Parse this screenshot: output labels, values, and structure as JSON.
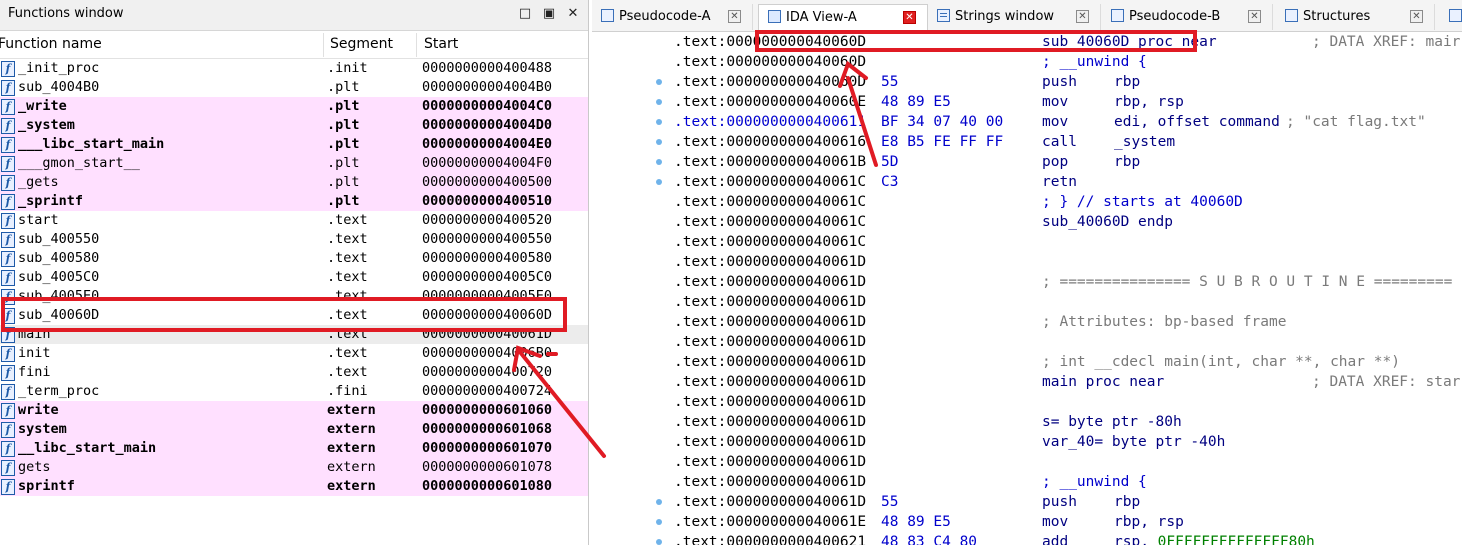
{
  "functions_window": {
    "title": "Functions window",
    "buttons": {
      "minimize": "□",
      "float": "▣",
      "close": "✕"
    },
    "columns": [
      "Function name",
      "Segment",
      "Start"
    ],
    "rows": [
      {
        "name": "_init_proc",
        "segment": ".init",
        "start": "0000000000400488",
        "style": ""
      },
      {
        "name": "sub_4004B0",
        "segment": ".plt",
        "start": "00000000004004B0",
        "style": ""
      },
      {
        "name": "_write",
        "segment": ".plt",
        "start": "00000000004004C0",
        "style": "plt b"
      },
      {
        "name": "_system",
        "segment": ".plt",
        "start": "00000000004004D0",
        "style": "plt b"
      },
      {
        "name": "___libc_start_main",
        "segment": ".plt",
        "start": "00000000004004E0",
        "style": "plt b"
      },
      {
        "name": "___gmon_start__",
        "segment": ".plt",
        "start": "00000000004004F0",
        "style": "plt"
      },
      {
        "name": "_gets",
        "segment": ".plt",
        "start": "0000000000400500",
        "style": "plt"
      },
      {
        "name": "_sprintf",
        "segment": ".plt",
        "start": "0000000000400510",
        "style": "plt b"
      },
      {
        "name": "start",
        "segment": ".text",
        "start": "0000000000400520",
        "style": ""
      },
      {
        "name": "sub_400550",
        "segment": ".text",
        "start": "0000000000400550",
        "style": ""
      },
      {
        "name": "sub_400580",
        "segment": ".text",
        "start": "0000000000400580",
        "style": ""
      },
      {
        "name": "sub_4005C0",
        "segment": ".text",
        "start": "00000000004005C0",
        "style": ""
      },
      {
        "name": "sub_4005E0",
        "segment": ".text",
        "start": "00000000004005E0",
        "style": ""
      },
      {
        "name": "sub_40060D",
        "segment": ".text",
        "start": "000000000040060D",
        "style": ""
      },
      {
        "name": "main",
        "segment": ".text",
        "start": "000000000040061D",
        "style": "sel"
      },
      {
        "name": "init",
        "segment": ".text",
        "start": "00000000004006B0",
        "style": ""
      },
      {
        "name": "fini",
        "segment": ".text",
        "start": "0000000000400720",
        "style": ""
      },
      {
        "name": "_term_proc",
        "segment": ".fini",
        "start": "0000000000400724",
        "style": ""
      },
      {
        "name": "write",
        "segment": "extern",
        "start": "0000000000601060",
        "style": "plt b"
      },
      {
        "name": "system",
        "segment": "extern",
        "start": "0000000000601068",
        "style": "plt b"
      },
      {
        "name": "__libc_start_main",
        "segment": "extern",
        "start": "0000000000601070",
        "style": "plt b"
      },
      {
        "name": "gets",
        "segment": "extern",
        "start": "0000000000601078",
        "style": "plt"
      },
      {
        "name": "sprintf",
        "segment": "extern",
        "start": "0000000000601080",
        "style": "plt b"
      }
    ]
  },
  "tabs": [
    {
      "label": "Pseudocode-A",
      "icon": "pseudocode-icon",
      "active": false
    },
    {
      "label": "IDA View-A",
      "icon": "ida-view-icon",
      "active": true
    },
    {
      "label": "Strings window",
      "icon": "strings-icon",
      "active": false
    },
    {
      "label": "Pseudocode-B",
      "icon": "pseudocode-icon",
      "active": false
    },
    {
      "label": "Structures",
      "icon": "structures-icon",
      "active": false
    }
  ],
  "disasm": [
    {
      "addr": ".text:000000000040060D",
      "bytes": "",
      "mn": "",
      "op": "",
      "label": "sub_40060D proc near",
      "comment": "; DATA XREF: mair",
      "dot": false
    },
    {
      "addr": ".text:000000000040060D",
      "bytes": "",
      "label": "; __unwind {",
      "dot": false
    },
    {
      "addr": ".text:000000000040060D",
      "bytes": "55",
      "mn": "push",
      "op": "rbp",
      "dot": true
    },
    {
      "addr": ".text:000000000040060E",
      "bytes": "48 89 E5",
      "mn": "mov",
      "op": "rbp, rsp",
      "dot": true
    },
    {
      "addr": ".text:0000000000400611",
      "bytes": "BF 34 07 40 00",
      "mn": "mov",
      "op": "edi, offset command",
      "comment": "; \"cat flag.txt\"",
      "dot": true,
      "blue": true
    },
    {
      "addr": ".text:0000000000400616",
      "bytes": "E8 B5 FE FF FF",
      "mn": "call",
      "op": "_system",
      "dot": true
    },
    {
      "addr": ".text:000000000040061B",
      "bytes": "5D",
      "mn": "pop",
      "op": "rbp",
      "dot": true
    },
    {
      "addr": ".text:000000000040061C",
      "bytes": "C3",
      "mn": "retn",
      "op": "",
      "dot": true
    },
    {
      "addr": ".text:000000000040061C",
      "bytes": "",
      "label": "; } // starts at 40060D",
      "dot": false
    },
    {
      "addr": ".text:000000000040061C",
      "bytes": "",
      "label": "sub_40060D endp",
      "dot": false
    },
    {
      "addr": ".text:000000000040061C",
      "bytes": "",
      "dot": false
    },
    {
      "addr": ".text:000000000040061D",
      "bytes": "",
      "dot": false
    },
    {
      "addr": ".text:000000000040061D",
      "bytes": "",
      "comment2": "; =============== S U B R O U T I N E =========",
      "dot": false
    },
    {
      "addr": ".text:000000000040061D",
      "bytes": "",
      "dot": false
    },
    {
      "addr": ".text:000000000040061D",
      "bytes": "",
      "comment2": "; Attributes: bp-based frame",
      "dot": false
    },
    {
      "addr": ".text:000000000040061D",
      "bytes": "",
      "dot": false
    },
    {
      "addr": ".text:000000000040061D",
      "bytes": "",
      "comment2": "; int __cdecl main(int, char **, char **)",
      "dot": false
    },
    {
      "addr": ".text:000000000040061D",
      "bytes": "",
      "label": "main proc near",
      "comment": "; DATA XREF: star",
      "dot": false
    },
    {
      "addr": ".text:000000000040061D",
      "bytes": "",
      "dot": false
    },
    {
      "addr": ".text:000000000040061D",
      "bytes": "",
      "label": "s= byte ptr -80h",
      "dot": false
    },
    {
      "addr": ".text:000000000040061D",
      "bytes": "",
      "label": "var_40= byte ptr -40h",
      "dot": false
    },
    {
      "addr": ".text:000000000040061D",
      "bytes": "",
      "dot": false
    },
    {
      "addr": ".text:000000000040061D",
      "bytes": "",
      "label": "; __unwind {",
      "dot": false
    },
    {
      "addr": ".text:000000000040061D",
      "bytes": "55",
      "mn": "push",
      "op": "rbp",
      "dot": true
    },
    {
      "addr": ".text:000000000040061E",
      "bytes": "48 89 E5",
      "mn": "mov",
      "op": "rbp, rsp",
      "dot": true
    },
    {
      "addr": ".text:0000000000400621",
      "bytes": "48 83 C4 80",
      "mn": "add",
      "op": "rsp, ",
      "hex": "0FFFFFFFFFFFFFF80h",
      "dot": true
    }
  ],
  "colors": {
    "annotation_red": "#e01b24",
    "plt_pink": "#ffe0ff",
    "code_blue": "#0000cc"
  }
}
